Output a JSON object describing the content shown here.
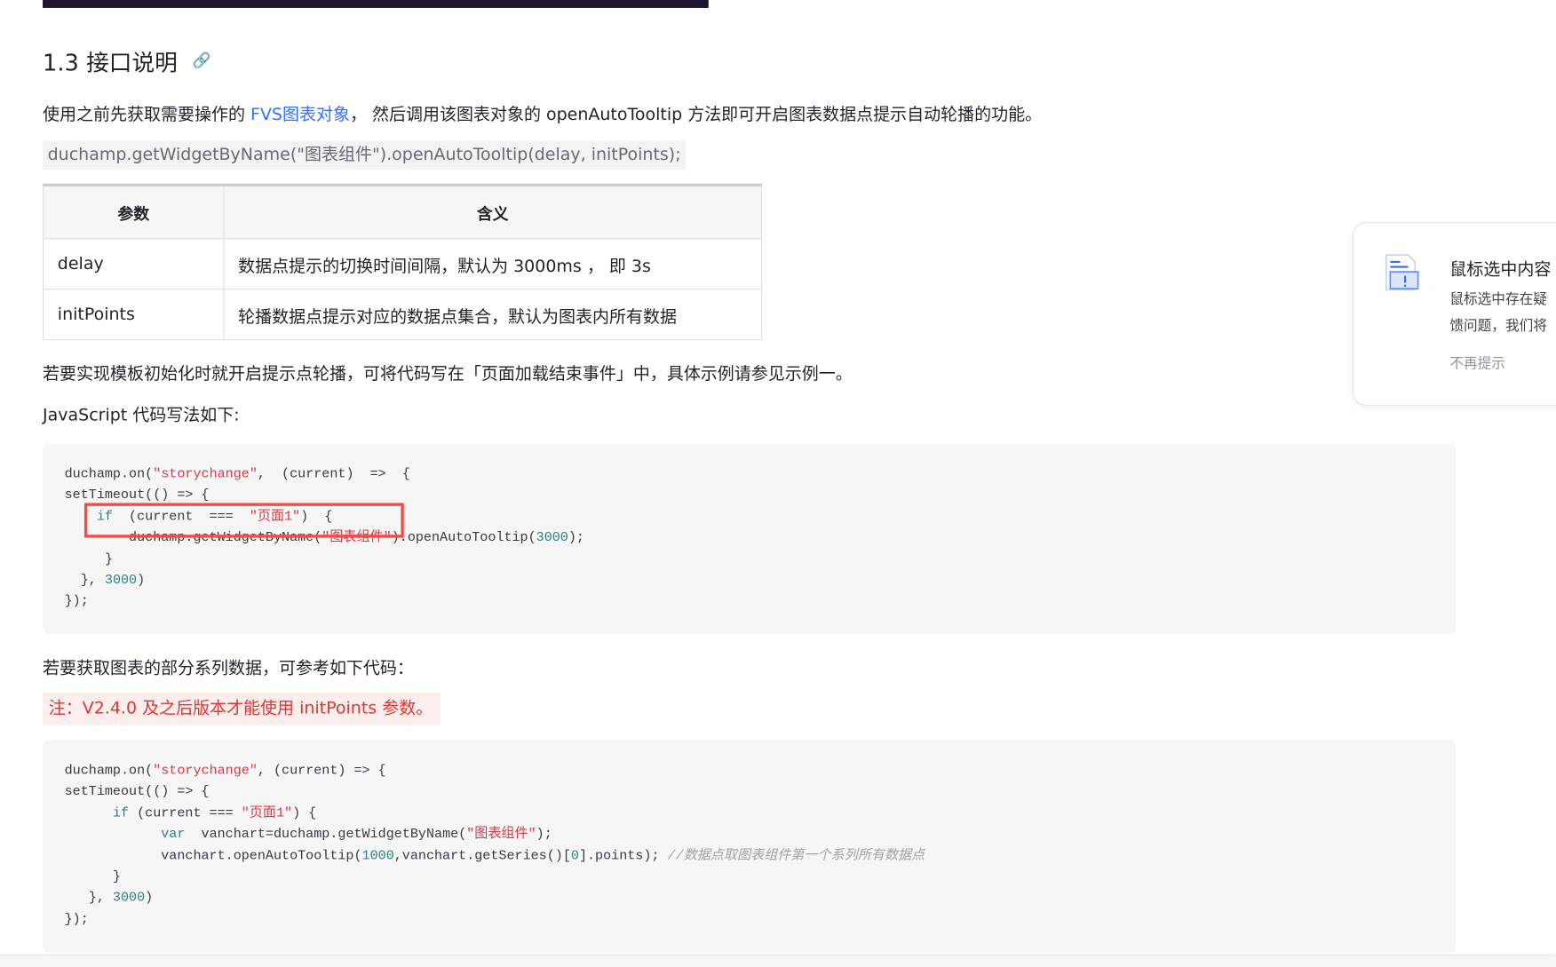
{
  "heading": "1.3 接口说明",
  "intro": {
    "before": "使用之前先获取需要操作的 ",
    "link": "FVS图表对象",
    "after": "， 然后调用该图表对象的 openAutoTooltip 方法即可开启图表数据点提示自动轮播的功能。"
  },
  "inline_code": "duchamp.getWidgetByName(\"图表组件\").openAutoTooltip(delay, initPoints);",
  "table": {
    "headers": [
      "参数",
      "含义"
    ],
    "rows": [
      [
        "delay",
        "数据点提示的切换时间间隔，默认为 3000ms ， 即 3s"
      ],
      [
        "initPoints",
        "轮播数据点提示对应的数据点集合，默认为图表内所有数据"
      ]
    ]
  },
  "para2": "若要实现模板初始化时就开启提示点轮播，可将代码写在「页面加载结束事件」中，具体示例请参见示例一。",
  "para3": "JavaScript 代码写法如下:",
  "code1": [
    [
      [
        "duchamp.on(",
        ""
      ],
      [
        "\"storychange\"",
        "s"
      ],
      [
        ",  (current)  =>  {",
        ""
      ]
    ],
    [
      [
        "setTimeout(() => {",
        ""
      ]
    ],
    [
      [
        "    ",
        ""
      ],
      [
        "if",
        "k"
      ],
      [
        "  (current  ===  ",
        ""
      ],
      [
        "\"页面1\"",
        "s"
      ],
      [
        ")  {",
        ""
      ]
    ],
    [
      [
        "        duchamp.getWidgetByName(",
        ""
      ],
      [
        "\"图表组件\"",
        "s"
      ],
      [
        ").openAutoTooltip(",
        ""
      ],
      [
        "3000",
        "n"
      ],
      [
        ");",
        ""
      ]
    ],
    [
      [
        "     }",
        ""
      ]
    ],
    [
      [
        "  }, ",
        ""
      ],
      [
        "3000",
        "n"
      ],
      [
        ")",
        ""
      ]
    ],
    [
      [
        "});",
        ""
      ]
    ]
  ],
  "para4": "若要获取图表的部分系列数据，可参考如下代码：",
  "note": "注：V2.4.0 及之后版本才能使用 initPoints 参数。",
  "code2": [
    [
      [
        "duchamp.on(",
        ""
      ],
      [
        "\"storychange\"",
        "s"
      ],
      [
        ", (current) => {",
        ""
      ]
    ],
    [
      [
        "setTimeout(() => {",
        ""
      ]
    ],
    [
      [
        "      ",
        ""
      ],
      [
        "if",
        "k"
      ],
      [
        " (current === ",
        ""
      ],
      [
        "\"页面1\"",
        "s"
      ],
      [
        ") {",
        ""
      ]
    ],
    [
      [
        "            ",
        ""
      ],
      [
        "var",
        "k"
      ],
      [
        "  vanchart=duchamp.getWidgetByName(",
        ""
      ],
      [
        "\"图表组件\"",
        "s"
      ],
      [
        ");",
        ""
      ]
    ],
    [
      [
        "            vanchart.openAutoTooltip(",
        ""
      ],
      [
        "1000",
        "n"
      ],
      [
        ",vanchart.getSeries()[",
        ""
      ],
      [
        "0",
        "n"
      ],
      [
        "].points); ",
        ""
      ],
      [
        "//数据点取图表组件第一个系列所有数据点",
        "c"
      ]
    ],
    [
      [
        "      }",
        ""
      ]
    ],
    [
      [
        "   }, ",
        ""
      ],
      [
        "3000",
        "n"
      ],
      [
        ")",
        ""
      ]
    ],
    [
      [
        "});",
        ""
      ]
    ]
  ],
  "card": {
    "title": "鼠标选中内容",
    "line1": "鼠标选中存在疑",
    "line2": "馈问题，我们将",
    "dismiss": "不再提示"
  }
}
